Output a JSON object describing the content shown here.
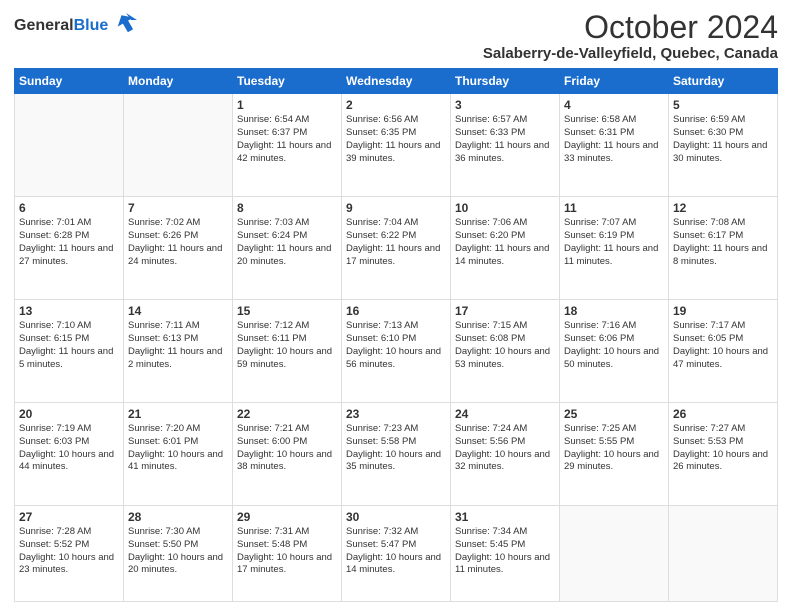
{
  "header": {
    "logo_general": "General",
    "logo_blue": "Blue",
    "month_year": "October 2024",
    "location": "Salaberry-de-Valleyfield, Quebec, Canada"
  },
  "days_of_week": [
    "Sunday",
    "Monday",
    "Tuesday",
    "Wednesday",
    "Thursday",
    "Friday",
    "Saturday"
  ],
  "weeks": [
    [
      {
        "day": "",
        "content": ""
      },
      {
        "day": "",
        "content": ""
      },
      {
        "day": "1",
        "content": "Sunrise: 6:54 AM\nSunset: 6:37 PM\nDaylight: 11 hours and 42 minutes."
      },
      {
        "day": "2",
        "content": "Sunrise: 6:56 AM\nSunset: 6:35 PM\nDaylight: 11 hours and 39 minutes."
      },
      {
        "day": "3",
        "content": "Sunrise: 6:57 AM\nSunset: 6:33 PM\nDaylight: 11 hours and 36 minutes."
      },
      {
        "day": "4",
        "content": "Sunrise: 6:58 AM\nSunset: 6:31 PM\nDaylight: 11 hours and 33 minutes."
      },
      {
        "day": "5",
        "content": "Sunrise: 6:59 AM\nSunset: 6:30 PM\nDaylight: 11 hours and 30 minutes."
      }
    ],
    [
      {
        "day": "6",
        "content": "Sunrise: 7:01 AM\nSunset: 6:28 PM\nDaylight: 11 hours and 27 minutes."
      },
      {
        "day": "7",
        "content": "Sunrise: 7:02 AM\nSunset: 6:26 PM\nDaylight: 11 hours and 24 minutes."
      },
      {
        "day": "8",
        "content": "Sunrise: 7:03 AM\nSunset: 6:24 PM\nDaylight: 11 hours and 20 minutes."
      },
      {
        "day": "9",
        "content": "Sunrise: 7:04 AM\nSunset: 6:22 PM\nDaylight: 11 hours and 17 minutes."
      },
      {
        "day": "10",
        "content": "Sunrise: 7:06 AM\nSunset: 6:20 PM\nDaylight: 11 hours and 14 minutes."
      },
      {
        "day": "11",
        "content": "Sunrise: 7:07 AM\nSunset: 6:19 PM\nDaylight: 11 hours and 11 minutes."
      },
      {
        "day": "12",
        "content": "Sunrise: 7:08 AM\nSunset: 6:17 PM\nDaylight: 11 hours and 8 minutes."
      }
    ],
    [
      {
        "day": "13",
        "content": "Sunrise: 7:10 AM\nSunset: 6:15 PM\nDaylight: 11 hours and 5 minutes."
      },
      {
        "day": "14",
        "content": "Sunrise: 7:11 AM\nSunset: 6:13 PM\nDaylight: 11 hours and 2 minutes."
      },
      {
        "day": "15",
        "content": "Sunrise: 7:12 AM\nSunset: 6:11 PM\nDaylight: 10 hours and 59 minutes."
      },
      {
        "day": "16",
        "content": "Sunrise: 7:13 AM\nSunset: 6:10 PM\nDaylight: 10 hours and 56 minutes."
      },
      {
        "day": "17",
        "content": "Sunrise: 7:15 AM\nSunset: 6:08 PM\nDaylight: 10 hours and 53 minutes."
      },
      {
        "day": "18",
        "content": "Sunrise: 7:16 AM\nSunset: 6:06 PM\nDaylight: 10 hours and 50 minutes."
      },
      {
        "day": "19",
        "content": "Sunrise: 7:17 AM\nSunset: 6:05 PM\nDaylight: 10 hours and 47 minutes."
      }
    ],
    [
      {
        "day": "20",
        "content": "Sunrise: 7:19 AM\nSunset: 6:03 PM\nDaylight: 10 hours and 44 minutes."
      },
      {
        "day": "21",
        "content": "Sunrise: 7:20 AM\nSunset: 6:01 PM\nDaylight: 10 hours and 41 minutes."
      },
      {
        "day": "22",
        "content": "Sunrise: 7:21 AM\nSunset: 6:00 PM\nDaylight: 10 hours and 38 minutes."
      },
      {
        "day": "23",
        "content": "Sunrise: 7:23 AM\nSunset: 5:58 PM\nDaylight: 10 hours and 35 minutes."
      },
      {
        "day": "24",
        "content": "Sunrise: 7:24 AM\nSunset: 5:56 PM\nDaylight: 10 hours and 32 minutes."
      },
      {
        "day": "25",
        "content": "Sunrise: 7:25 AM\nSunset: 5:55 PM\nDaylight: 10 hours and 29 minutes."
      },
      {
        "day": "26",
        "content": "Sunrise: 7:27 AM\nSunset: 5:53 PM\nDaylight: 10 hours and 26 minutes."
      }
    ],
    [
      {
        "day": "27",
        "content": "Sunrise: 7:28 AM\nSunset: 5:52 PM\nDaylight: 10 hours and 23 minutes."
      },
      {
        "day": "28",
        "content": "Sunrise: 7:30 AM\nSunset: 5:50 PM\nDaylight: 10 hours and 20 minutes."
      },
      {
        "day": "29",
        "content": "Sunrise: 7:31 AM\nSunset: 5:48 PM\nDaylight: 10 hours and 17 minutes."
      },
      {
        "day": "30",
        "content": "Sunrise: 7:32 AM\nSunset: 5:47 PM\nDaylight: 10 hours and 14 minutes."
      },
      {
        "day": "31",
        "content": "Sunrise: 7:34 AM\nSunset: 5:45 PM\nDaylight: 10 hours and 11 minutes."
      },
      {
        "day": "",
        "content": ""
      },
      {
        "day": "",
        "content": ""
      }
    ]
  ]
}
